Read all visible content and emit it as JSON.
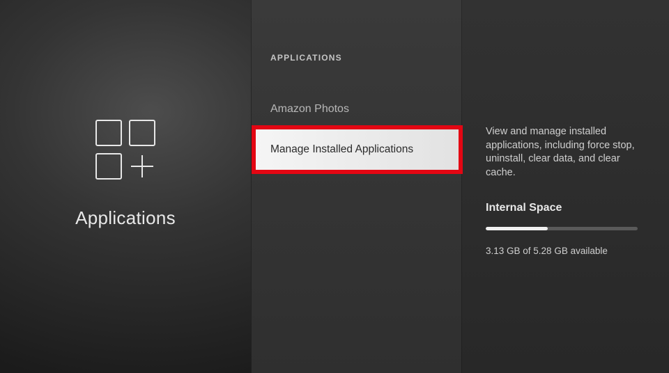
{
  "left": {
    "title": "Applications"
  },
  "middle": {
    "heading": "APPLICATIONS",
    "items": [
      {
        "label": "Amazon Photos"
      },
      {
        "label": "Manage Installed Applications"
      }
    ]
  },
  "right": {
    "description": "View and manage installed applications, including force stop, uninstall, clear data, and clear cache.",
    "space_heading": "Internal Space",
    "space_available": "3.13 GB of 5.28 GB available",
    "progress_percent": 41
  }
}
